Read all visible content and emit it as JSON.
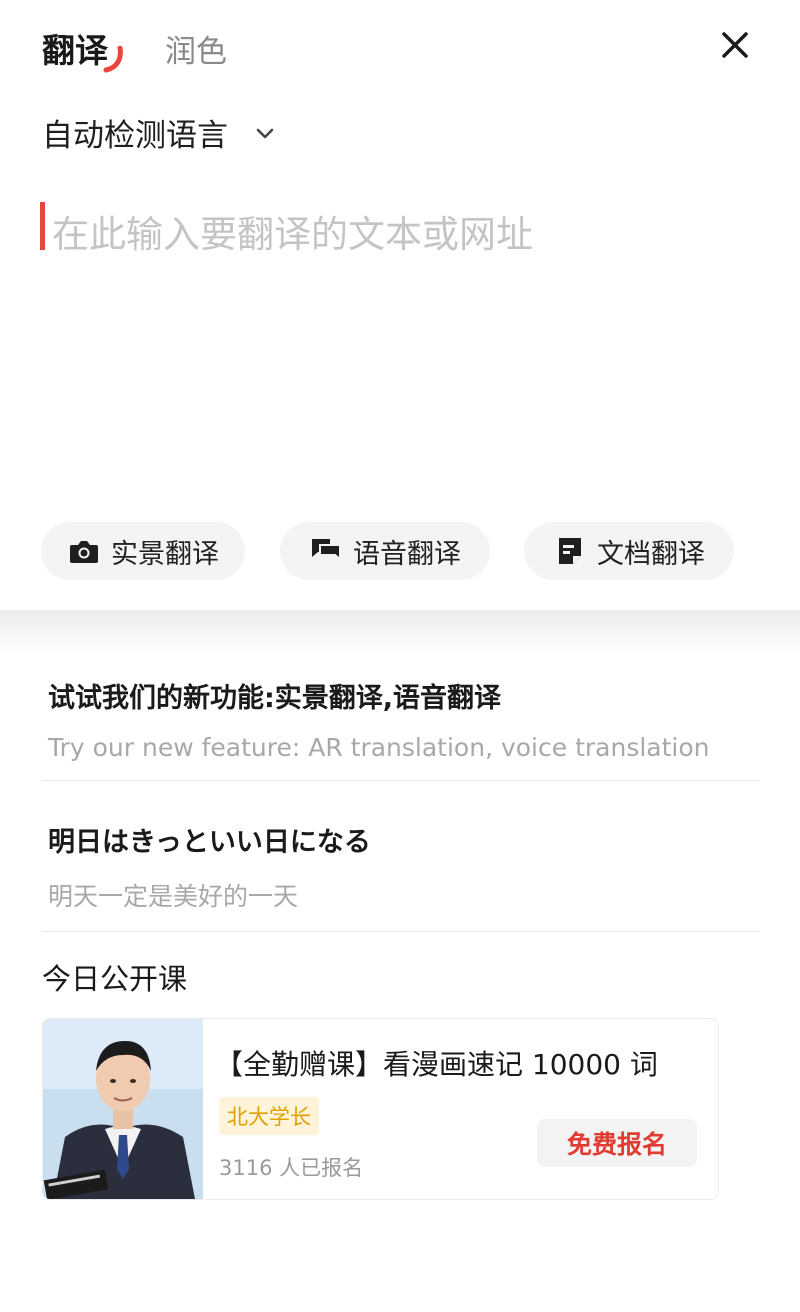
{
  "tabs": {
    "active": "翻译",
    "inactive": "润色"
  },
  "language": {
    "label": "自动检测语言"
  },
  "input": {
    "placeholder": "在此输入要翻译的文本或网址"
  },
  "features": [
    {
      "label": "实景翻译",
      "icon": "camera-icon"
    },
    {
      "label": "语音翻译",
      "icon": "chat-bubbles-icon"
    },
    {
      "label": "文档翻译",
      "icon": "document-icon"
    }
  ],
  "suggestions": [
    {
      "main": "试试我们的新功能:实景翻译,语音翻译",
      "sub": "Try our new feature: AR translation, voice translation"
    },
    {
      "main": "明日はきっといい日になる",
      "sub": "明天一定是美好的一天"
    }
  ],
  "course_section": {
    "title": "今日公开课",
    "course": {
      "title": "【全勤赠课】看漫画速记 10000 词",
      "tag": "北大学长",
      "enrolled": "3116 人已报名",
      "button": "免费报名"
    }
  },
  "colors": {
    "accent": "#e8453c",
    "tag_bg": "#fff4d9",
    "tag_text": "#e0a000"
  }
}
